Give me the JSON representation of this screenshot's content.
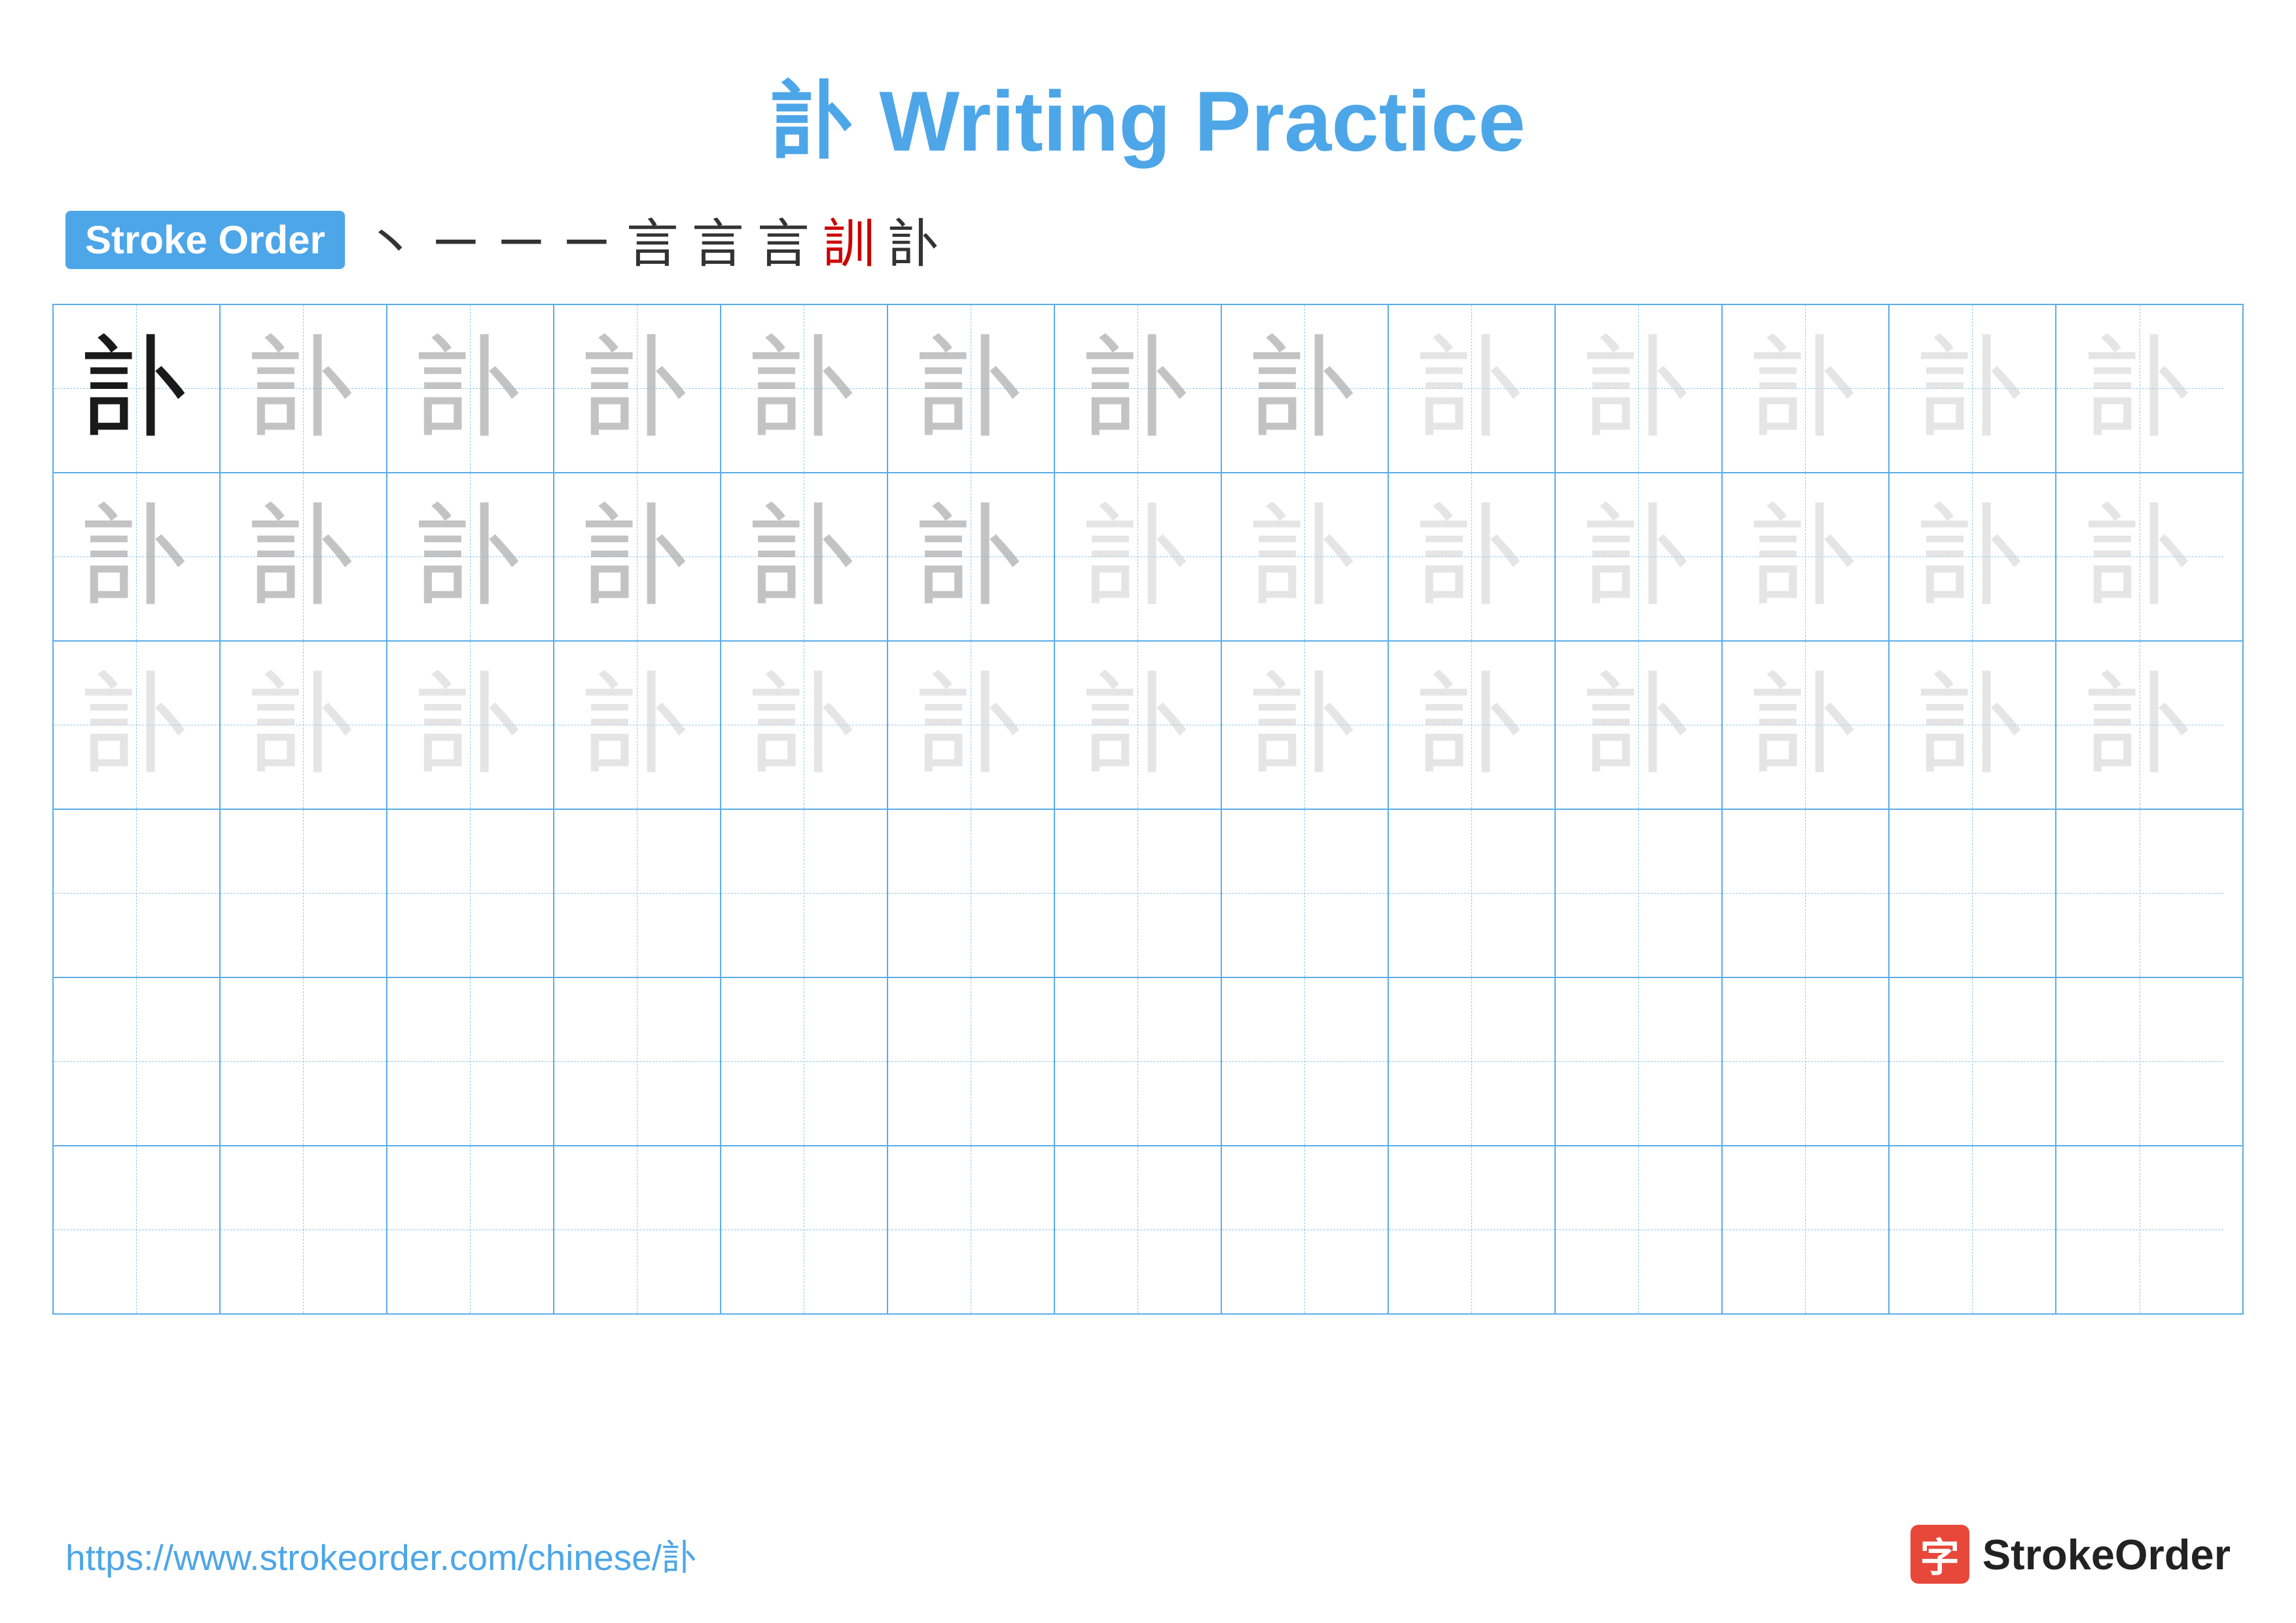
{
  "title": {
    "chinese_char": "訃",
    "label": "Writing Practice",
    "full_title": "訃Writing Practice"
  },
  "stroke_order": {
    "badge_label": "Stroke Order",
    "strokes": [
      "丶",
      "ㄧ",
      "ㄧ",
      "ㄧ",
      "ㄧ",
      "ㄧ",
      "ㄧ",
      "訓",
      "訃"
    ]
  },
  "grid": {
    "rows": 6,
    "cols": 13,
    "character": "訃"
  },
  "footer": {
    "url": "https://www.strokeorder.com/chinese/訃",
    "logo_char": "字",
    "logo_text": "StrokeOrder"
  }
}
